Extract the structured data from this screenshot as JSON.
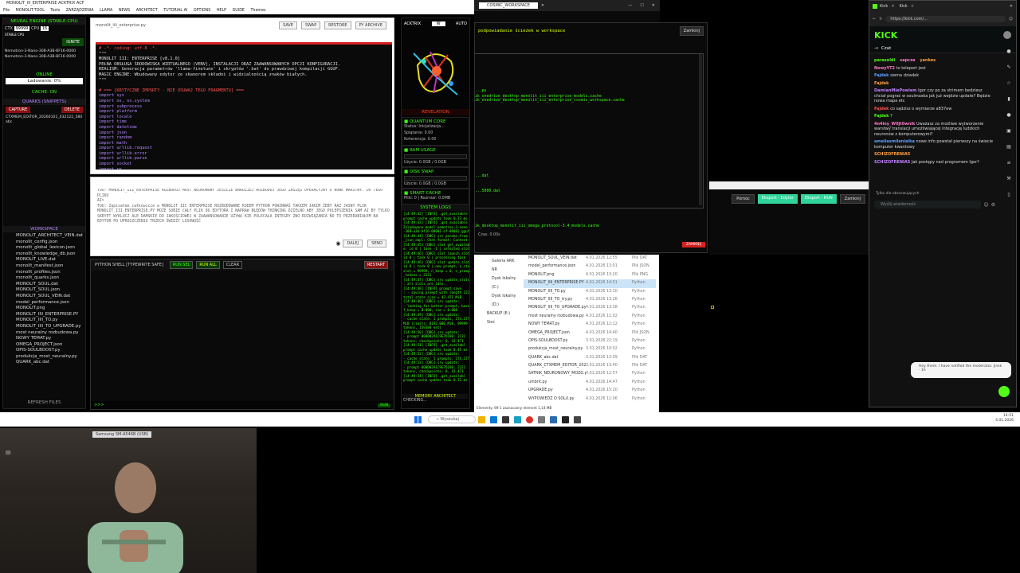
{
  "ide": {
    "title": "MONOLIT_III_ENTERPRISE ACKTRIX ACF",
    "menu": [
      "File",
      "MONOLIT-TOOL",
      "Tools",
      "ZARZĄDZENIA",
      "LLAMA",
      "NEWS",
      "ARCHITECT",
      "TUTORIAL AI",
      "OPTIONS",
      "HELP",
      "GUIDE",
      "Themes"
    ],
    "neural_engine": "NEURAL ENGINE (STABLE-CPU)",
    "ctx_label": "CTX",
    "ctx_value": "99999",
    "cpu_label": "CPU",
    "cpu_value": "16",
    "stable_cpu": "STABLE CPU",
    "ignite": "IGNITE",
    "models": [
      "Nemotron-3-Nano-30B-A3B-BF16-0000",
      "Nemotron-3-Nano-30B-A3B-BF16-0000"
    ],
    "online": "ONLINE",
    "loading": "Ładowanie: 0%",
    "cache_on": "CACHE: ON",
    "quarks": "QUARKS (SNIPPETS)",
    "capture": "CAPTURE",
    "delete": "DELETE",
    "snippet": "CTXMEM_EDITOR_20260101_032122_580 abc",
    "workspace": "WORKSPACE",
    "files": [
      "MONOLIT_ARCHITECT_VEIN.dat",
      "monolit_config.json",
      "monolit_global_lexicon.json",
      "monolit_knowledge_db.json",
      "MONOLIT_LIVE.dat",
      "monolit_manifest.json",
      "monolit_profiles.json",
      "monolit_quarks.json",
      "MONOLIT_SOUL.dat",
      "MONOLIT_SOUL.json",
      "MONOLIT_SOUL_VEIN.dat",
      "model_performance.json",
      "MONOLIT.png",
      "MONOLIT_IIII_ENTERPRISE.PY",
      "MONOLIT_IIII_TO.py",
      "MONOLIT_IIII_TO_UPGRADE.py",
      "most neuralny rozbudowa.py",
      "NOWY TEMAT.py",
      "OMEGA_PROJECT.json",
      "OPIS-SOULBOOST.py",
      "produkcja_most_neuralny.py",
      "QUARK_abc.dat"
    ],
    "refresh": "REFRESH FILES",
    "editor_file": "monolit_iiii_enterprise.py",
    "editor_buttons": [
      "SAVE",
      "SWAP",
      "RESTORE",
      "PY ARCHIVE"
    ],
    "code_lines": [
      "# -*- coding: utf-8 -*-",
      "\"\"\"",
      "MONOLIT III: ENTERPRISE [v8.1.0]",
      "PEŁNA OBSŁUGA ŚRODOWISKA WIRTUALNEGO (VENV), INSTALACJI ORAZ ZAAWANSOWANYCH OPCJI KONFIGURACJI.",
      "REALISM: Generacja parametrów 'llama-finetune' i skryptów '.bat' do prawdziwej kompilacji GGUF.",
      "MAGIC ENGINE: Wbudowany edytor ze skanerem składni i widzialnością znaków białych.",
      "\"\"\"",
      "",
      "# === [KRYTYCZNE IMPORTY - NIE USUWAJ TEGO FRAGMENTU] ===",
      "import sys",
      "import os, os.system",
      "import subprocess",
      "import platform",
      "import locale",
      "import time",
      "import datetime",
      "import json",
      "import random",
      "import math",
      "import urllib.request",
      "import urllib.error",
      "import urllib.parse",
      "import socket",
      "import re"
    ],
    "prompt_text": "TOU: MONOLIT_III_ENTERPRISE ROZBUDUJ MOST NEURONOWY JESZCZE BARDZIEJ ROZBUDUJ JEGO ZASIĘG OPERACYJNY O NOWE WARSTWY. DO TEGO PLIKU\nAI>\nTOU: Zapisałem całkowicie w MONOLIT IIC ENTERPRISE ROZBUDOWANE KODEM PYTHON POWINNAŚ TAKIEM JAKIM ŻEBY RAZ JASNY PLIK MONOLIT_III_ENTERPRISE.PY MOŻE SOBIE CAŁY PLIK DO EDYTORA I NAPRAW BŁĘDÓW THINKING DZIELNO ABY JEGO POLEPSZENIA SAM AI BY TYLKO SKRYPT WYKLUCZ ALE DAMSKIE DO JAKOŚCIOWEJ W ZAAWANSOWANIE UŻYWA KIE POLECAŁA INTEGRY ZNO ROZWIĄZANIA NO TO PRZERABIAŁEM NA EDYTOR PO UPROSZCZENIU TRZECH ŚWIEŻY LOSOWOŚĆ",
    "dalej": "DALEJ",
    "send": "SEND",
    "shell_title": "PYTHON SHELL [TYPEWRITE SAFE]",
    "shell_buttons": [
      "RUN SEL",
      "RUN ALL",
      "CLEAR"
    ],
    "restart": "RESTART",
    "shell_prompt": ">>>",
    "shell_run": "RUN",
    "acktrix": "ACKTRIX",
    "auto": "AUTO",
    "w_label": "W",
    "revelation": "REVELATION",
    "quantum_core": "QUANTUM CORE",
    "quantum_status": "Status: Inicjalizacja...",
    "quantum_spl": "Splątanie: 0.00",
    "quantum_koh": "Koherencja: 0.00",
    "ram_usage": "RAM USAGE",
    "ram_value": "Użycie: 0.0GB / 0.0GB",
    "disk_swap": "DISK SWAP",
    "disk_value": "Użycie: 0.0GB / 0.0GB",
    "smart_cache": "SMART CACHE",
    "cache_value": "Pliki: 0 | Rozmiar: 0.0MB",
    "system_logs": "SYSTEM LOGS",
    "logs": [
      "[14:49:42] [INFO] .get_available",
      "prompt cache update took 0.73 ms",
      "[14:49:43] [INFO] .get_available",
      "Zaladowano model nemotron-3-nano",
      "-30B-a3b-bf16-00001-of-00002.gguf",
      "[14:49:44] [DBG] srv  params_from",
      "_json_cmpl: Chat format: Content-only",
      "[14:49:45] [DBG] slot get_availabl",
      "e: id 0 | task -1 | selected slot",
      "[14:49:46] [DBG] slot launch_slot_:",
      "id 0 | task 0 | processing task",
      "[14:49:46] [DBG] slot update_slots:",
      "id 0 | task 0 | new prompt, n_ctx_",
      "slot = 99999, n_keep = 0, n_prompt",
      "_tokens = 2221",
      "[14:49:47] [DBG] srv  update_slots",
      ": all slots are idle",
      "[14:49:48] [INFO] prompt_save",
      ": - saving prompt with length 2221,",
      "total state size = 43.471 MiB",
      "[14:49:48] [DBG] srv  update:",
      " - looking for better prompt, base",
      " f_keep = 0.000, sim = 0.000",
      "[14:49:49] [DBG] srv  update:",
      " - cache state: 1 prompts, 274.277",
      " MiB (limits: 8192.000 MiB, 99999",
      " tokens, 159388 est)",
      "[14:49:50] [DBG] srv  update:",
      " - prompt 000002A1C9E7D180: 2221",
      " tokens, checkpoints: 0, 43.471",
      "[14:49:51] [INFO] .get_availabl",
      "prompt cache update took 0.45 ms",
      "[14:49:52] [DBG] srv  update:",
      " - cache state: 1 prompts, 274.277",
      "[14:49:53] [DBG] srv  update:",
      " - prompt 000002A1C9E7D180: 2221",
      " tokens, checkpoints: 0, 43.471",
      "[14:49:54] [INFO] .get_availabl",
      "prompt cache update took 0.73 ms"
    ],
    "memory_architect": "MEMORY ARCHITECT",
    "checking": "CHECKING..."
  },
  "workspace_dialog": {
    "tab": "COSMIC_WORKSPACE",
    "heading": "podpowiadanie ścieżek w workspace",
    "close": "Zamknij",
    "lines": [
      "...py",
      "ik_onedrive_desktop_monolit_iii_enterprise_models.cache",
      "ik_onedrive_desktop_monolit_iii_enterprise_cosmic_workspace.cache",
      "...dat",
      "...5000.dat",
      "ik_desktop_monolit_iii_omega_protocol-3.4_models.cache"
    ],
    "time": "Czas: 0.00s",
    "bottom_close": "ZAMKNIJ",
    "buttons": [
      "Pomoc",
      "Eksport - Edytor",
      "Eksport - RUN",
      "Zamknij"
    ]
  },
  "explorer": {
    "tree": [
      "Galeria ARK NR",
      "Dysk lokalny (C:)",
      "Dysk lokalny (D:)",
      "BACKUP (E:)",
      "Sieć"
    ],
    "files": [
      {
        "name": "MONOLIT_SOUL_VEIN.dat",
        "date": "4.01.2026 12:55",
        "type": "Plik DAT"
      },
      {
        "name": "model_performance.json",
        "date": "4.01.2026 13:01",
        "type": "Plik JSON"
      },
      {
        "name": "MONOLIT.png",
        "date": "4.01.2026 13:20",
        "type": "Plik PNG"
      },
      {
        "name": "MONOLIT_IIII_ENTERPRISE.PY",
        "date": "4.01.2026 14:51",
        "type": "Python"
      },
      {
        "name": "MONOLIT_IIII_TO.py",
        "date": "4.01.2026 13:10",
        "type": "Python"
      },
      {
        "name": "MONOLIT_IIII_TO_try.py",
        "date": "4.01.2026 13:26",
        "type": "Python"
      },
      {
        "name": "MONOLIT_IIII_TO_UPGRADE.py",
        "date": "4.01.2026 13:38",
        "type": "Python"
      },
      {
        "name": "most neuralny rozbudowa.py",
        "date": "4.01.2026 11:02",
        "type": "Python"
      },
      {
        "name": "NOWY TEMAT.py",
        "date": "4.01.2026 12:12",
        "type": "Python"
      },
      {
        "name": "OMEGA_PROJECT.json",
        "date": "4.01.2026 14:40",
        "type": "Plik JSON"
      },
      {
        "name": "OPIS-SOULBOOST.py",
        "date": "3.01.2026 22:19",
        "type": "Python"
      },
      {
        "name": "produkcja_most_neuralny.py",
        "date": "3.01.2026 10:02",
        "type": "Python"
      },
      {
        "name": "QUARK_abc.dat",
        "date": "3.01.2026 13:09",
        "type": "Plik DAT"
      },
      {
        "name": "QUARK_CTXMEM_EDITOR_2026010...",
        "date": "3.01.2026 13:40",
        "type": "Plik DAT"
      },
      {
        "name": "SATNIK_NEURONOWY_MOZG.py",
        "date": "4.01.2026 12:57",
        "type": "Python"
      },
      {
        "name": "umbrit.py",
        "date": "4.01.2026 14:47",
        "type": "Python"
      },
      {
        "name": "UPGRADE.py",
        "date": "4.01.2026 15:20",
        "type": "Python"
      },
      {
        "name": "WYPOWIEDZ O SOLU.py",
        "date": "4.01.2026 11:06",
        "type": "Python"
      }
    ],
    "status": "Elementy: 69    1 zaznaczony element  1,14 MB"
  },
  "kick": {
    "url": "https://kick.com/...",
    "tab1": "Kick",
    "tab2": "Kick",
    "logo": "KICK",
    "chat_title": "Czat",
    "messages": [
      {
        "user": "parasoldi",
        "text": "",
        "extra": "sapcza",
        "extra2": "yankes"
      },
      {
        "user": "NowyYT2",
        "text": "to teleport jest"
      },
      {
        "user": "Fajdek",
        "text": "siema dziadek"
      },
      {
        "user": "Fajdek",
        "text": ""
      },
      {
        "user": "DamianMiePowiem",
        "text": "Igor czy po za strimem bedziesz chciał pograć w soulmaska jak już wejdzie update? Będzie nowa mapa etc"
      },
      {
        "user": "Fajdek",
        "text": "co sądzisz o wymiarze a837ew"
      },
      {
        "user": "Fajdek",
        "text": "?"
      },
      {
        "user": "4n4lny_W0jt0wnik",
        "text": "Uważasz za możliwe wytworzenie warstwy translacji umożliwiającej integrację ludzkich neuronów z komputerowymi?"
      },
      {
        "user": "ameliasmilenialka",
        "text": "nowe info powstał pierwszy na świecie komputer kwantowy"
      },
      {
        "user": "SCHIZOFRENIA5",
        "text": ""
      },
      {
        "user": "SCHIZOFRENIA5",
        "text": "Jak postępy nad programem Igor?"
      }
    ],
    "followers_only": "Tylko dla obserwujących",
    "send_placeholder": "Wyślij wiadomość",
    "toast": "Hey there. I have notified the moderator. Jinsk · 1h"
  },
  "camera": {
    "label": "Samsung SM-A546B (USB)"
  },
  "taskbar": {
    "search": "Wyszukaj",
    "clock": "14:51",
    "date": "4.01.2026"
  },
  "colors": {
    "accent_green": "#39ff14",
    "accent_red": "#d42020",
    "kick_green": "#53fc18",
    "panel": "#0a0a0a"
  }
}
